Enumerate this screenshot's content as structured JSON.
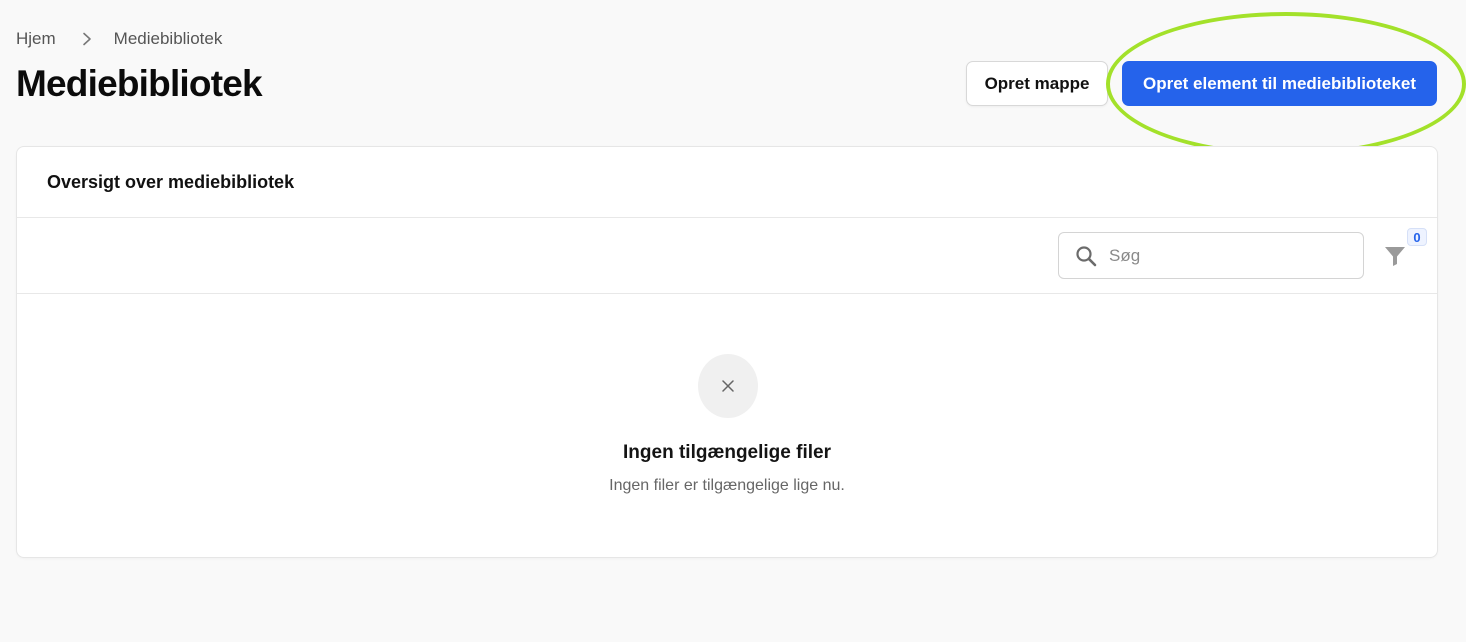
{
  "breadcrumb": {
    "home": "Hjem",
    "current": "Mediebibliotek"
  },
  "page": {
    "title": "Mediebibliotek"
  },
  "actions": {
    "create_folder": "Opret mappe",
    "create_item": "Opret element til mediebiblioteket"
  },
  "card": {
    "title": "Oversigt over mediebibliotek"
  },
  "toolbar": {
    "search_placeholder": "Søg",
    "search_value": "",
    "filter_count": "0"
  },
  "empty_state": {
    "title": "Ingen tilgængelige filer",
    "description": "Ingen filer er tilgængelige lige nu."
  },
  "icons": {
    "breadcrumb_separator": "chevron-right-icon",
    "search": "search-icon",
    "filter": "filter-icon",
    "empty": "close-icon"
  },
  "colors": {
    "primary": "#2563eb",
    "highlight": "#a3e12a",
    "background": "#f9f9f9"
  }
}
